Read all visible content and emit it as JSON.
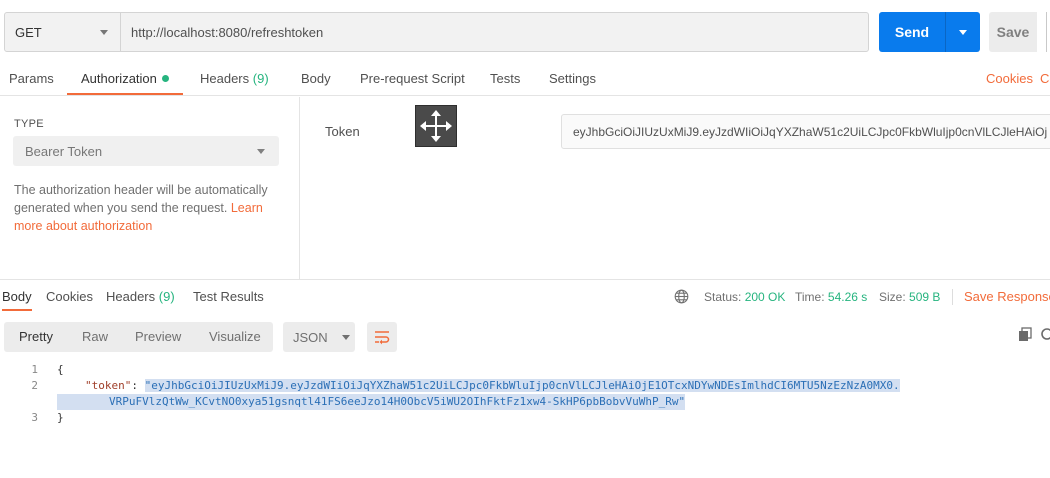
{
  "request": {
    "method": "GET",
    "url": "http://localhost:8080/refreshtoken",
    "send_label": "Send",
    "save_label": "Save"
  },
  "req_tabs": {
    "params": "Params",
    "authorization": "Authorization",
    "headers": "Headers",
    "headers_count": "(9)",
    "body": "Body",
    "prerequest": "Pre-request Script",
    "tests": "Tests",
    "settings": "Settings",
    "cookies": "Cookies",
    "cookies_partial": "Co"
  },
  "auth": {
    "type_label": "TYPE",
    "type_value": "Bearer Token",
    "description": "The authorization header will be automatically generated when you send the request.",
    "learn_more": "Learn more about authorization",
    "token_label": "Token",
    "token_value": "eyJhbGciOiJIUzUxMiJ9.eyJzdWIiOiJqYXZhaW51c2UiLCJpc0FkbWluIjp0cnVlLCJleHAiOj ..."
  },
  "response": {
    "tabs": {
      "body": "Body",
      "cookies": "Cookies",
      "headers": "Headers",
      "headers_count": "(9)",
      "test_results": "Test Results"
    },
    "status_label": "Status:",
    "status_value": "200 OK",
    "time_label": "Time:",
    "time_value": "54.26 s",
    "size_label": "Size:",
    "size_value": "509 B",
    "save_label": "Save Response",
    "views": {
      "pretty": "Pretty",
      "raw": "Raw",
      "preview": "Preview",
      "visualize": "Visualize"
    },
    "format": "JSON",
    "code": {
      "ln1": "1",
      "ln2": "2",
      "ln3": "3",
      "open_brace": "{",
      "key": "\"token\"",
      "colon": ": ",
      "value_part1": "\"eyJhbGciOiJIUzUxMiJ9.eyJzdWIiOiJqYXZhaW51c2UiLCJpc0FkbWluIjp0cnVlLCJleHAiOjE1OTcxNDYwNDEsImlhdCI6MTU5NzEzNzA0MX0.",
      "value_part2": "VRPuFVlzQtWw_KCvtNO0xya51gsnqtl41FS6eeJzo14H0ObcV5iWU2OIhFktFz1xw4-SkHP6pbBobvVuWhP_Rw\"",
      "close_brace": "}"
    }
  },
  "colors": {
    "accent": "#f26b3a",
    "primary": "#097bed",
    "success": "#26b47f"
  }
}
